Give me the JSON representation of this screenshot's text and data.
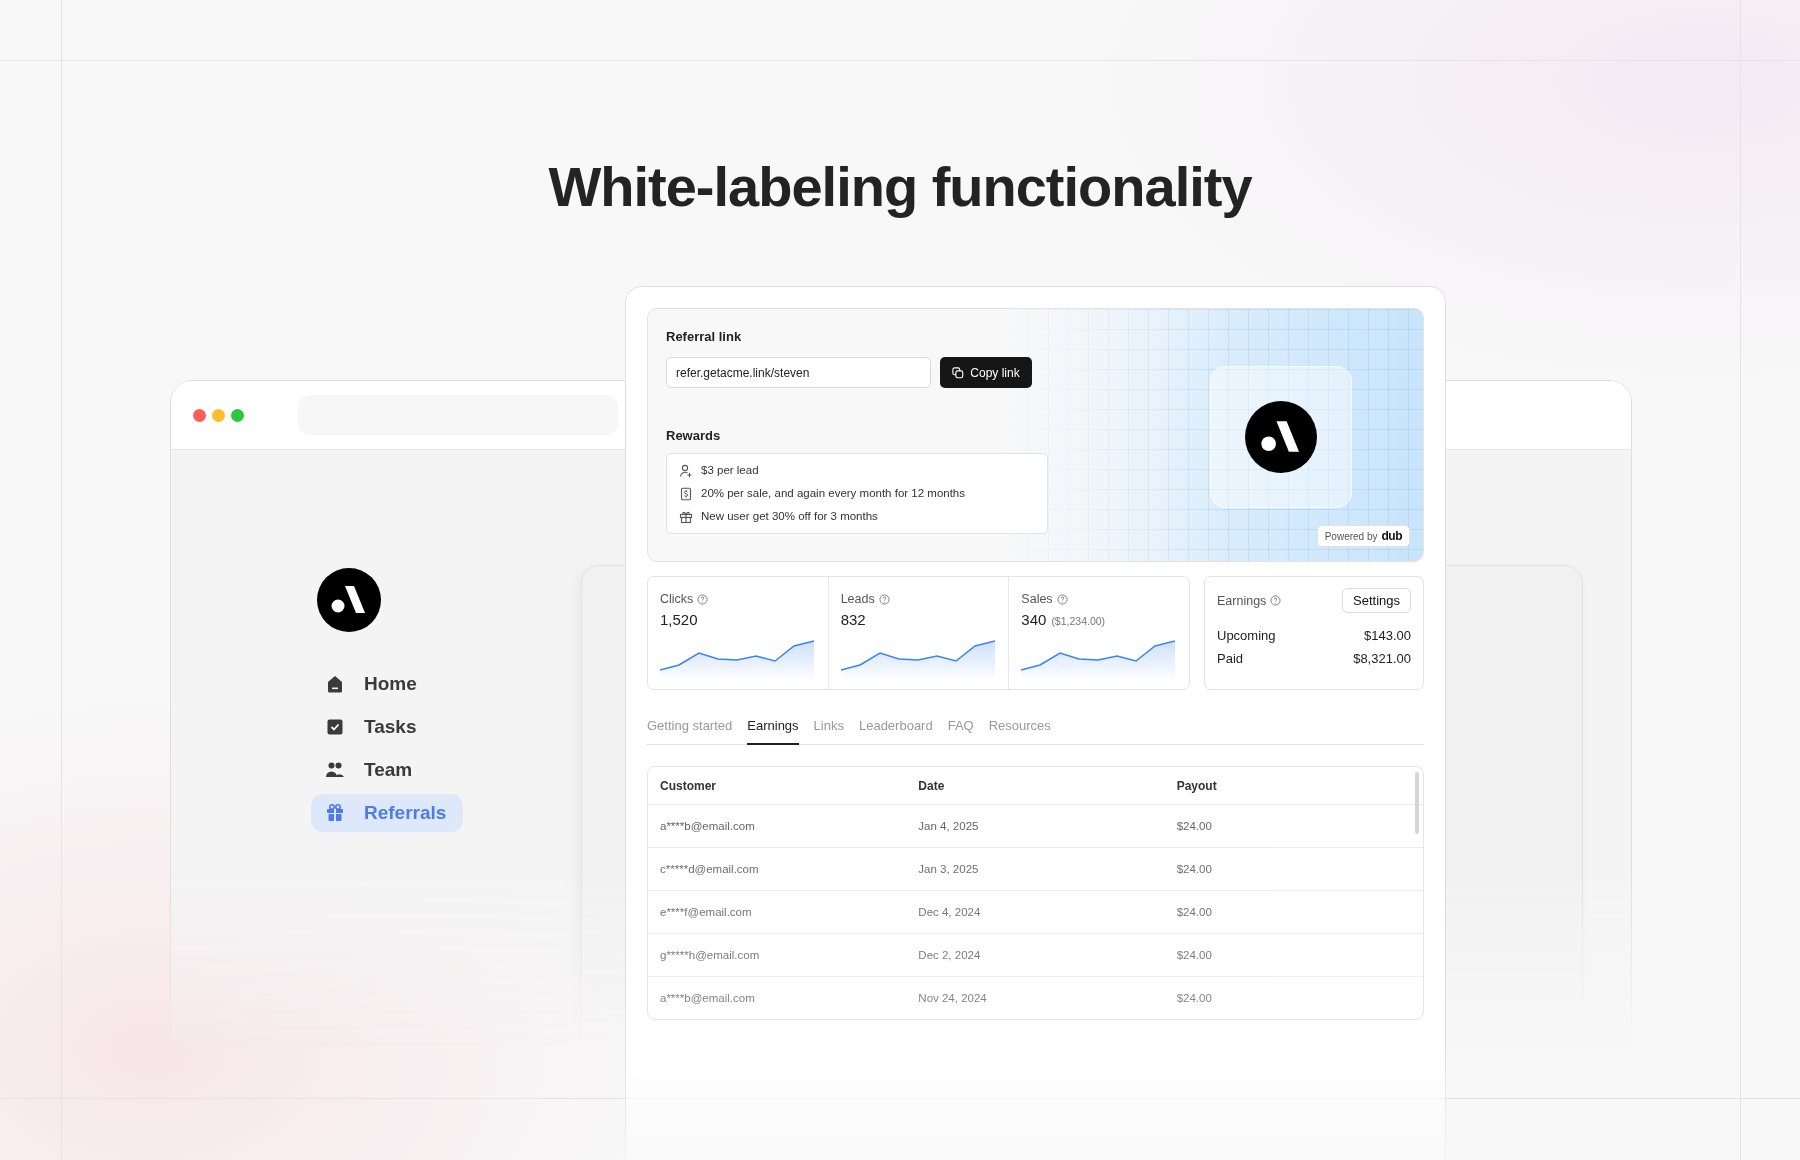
{
  "heading": "White-labeling functionality",
  "sidebar": {
    "items": [
      {
        "label": "Home",
        "kind": "home",
        "selected": false
      },
      {
        "label": "Tasks",
        "kind": "tasks",
        "selected": false
      },
      {
        "label": "Team",
        "kind": "team",
        "selected": false
      },
      {
        "label": "Referrals",
        "kind": "gift",
        "selected": true
      }
    ]
  },
  "referral": {
    "link_label": "Referral link",
    "link_value": "refer.getacme.link/steven",
    "copy_button": "Copy link",
    "rewards_label": "Rewards",
    "rewards": [
      {
        "kind": "lead",
        "text": "$3 per lead"
      },
      {
        "kind": "sale",
        "text": "20% per sale, and again every month for 12 months"
      },
      {
        "kind": "discount",
        "text": "New user get 30% off for 3 months"
      }
    ],
    "powered_by": "Powered by",
    "powered_brand": "dub"
  },
  "stats": [
    {
      "label": "Clicks",
      "value": "1,520"
    },
    {
      "label": "Leads",
      "value": "832"
    },
    {
      "label": "Sales",
      "value": "340",
      "note": "($1,234.00)"
    }
  ],
  "earnings": {
    "label": "Earnings",
    "button": "Settings",
    "rows": [
      {
        "label": "Upcoming",
        "amount": "$143.00"
      },
      {
        "label": "Paid",
        "amount": "$8,321.00"
      }
    ]
  },
  "tabs": [
    {
      "label": "Getting started",
      "selected": false
    },
    {
      "label": "Earnings",
      "selected": true
    },
    {
      "label": "Links",
      "selected": false
    },
    {
      "label": "Leaderboard",
      "selected": false
    },
    {
      "label": "FAQ",
      "selected": false
    },
    {
      "label": "Resources",
      "selected": false
    }
  ],
  "table": {
    "columns": [
      "Customer",
      "Date",
      "Payout"
    ],
    "rows": [
      [
        "a****b@email.com",
        "Jan 4, 2025",
        "$24.00"
      ],
      [
        "c*****d@email.com",
        "Jan 3, 2025",
        "$24.00"
      ],
      [
        "e****f@email.com",
        "Dec 4, 2024",
        "$24.00"
      ],
      [
        "g*****h@email.com",
        "Dec 2, 2024",
        "$24.00"
      ],
      [
        "a****b@email.com",
        "Nov 24, 2024",
        "$24.00"
      ]
    ]
  }
}
